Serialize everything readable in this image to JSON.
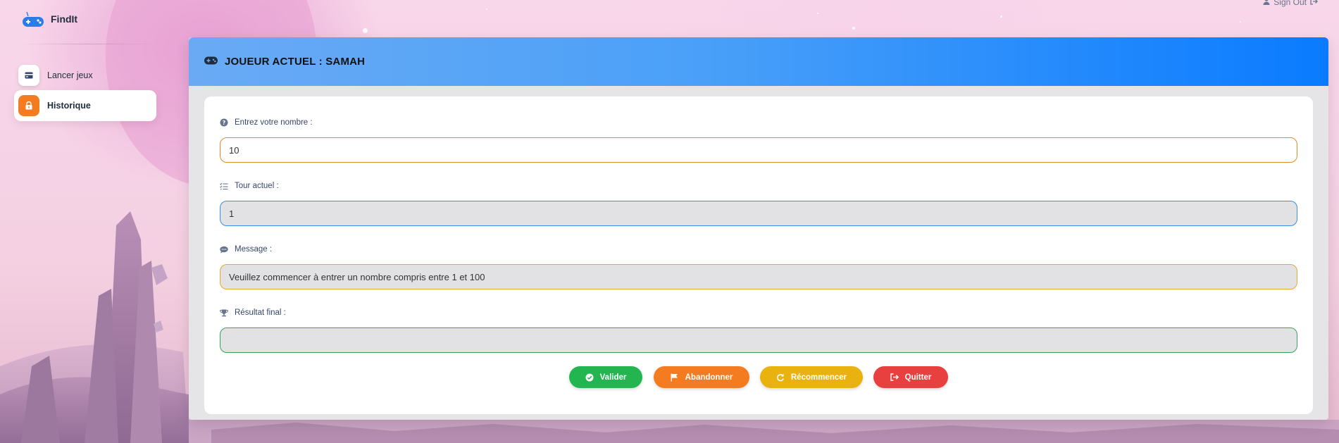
{
  "brand": {
    "name": "FindIt",
    "logo_icon": "gamepad-logo-icon"
  },
  "top_bar": {
    "signout_label": "Sign Out"
  },
  "sidebar": {
    "items": [
      {
        "label": "Lancer jeux",
        "icon": "card-icon",
        "active": false
      },
      {
        "label": "Historique",
        "icon": "lock-icon",
        "active": true
      }
    ]
  },
  "panel": {
    "title": "JOUEUR ACTUEL : SAMAH",
    "title_icon": "gamepad-icon",
    "fields": [
      {
        "label": "Entrez votre nombre :",
        "icon": "question-circle-icon",
        "value": "10",
        "border": "#e0892f"
      },
      {
        "label": "Tour actuel :",
        "icon": "list-check-icon",
        "value": "1",
        "border": "#3b8ee4"
      },
      {
        "label": "Message :",
        "icon": "comment-icon",
        "value": "Veuillez commencer à entrer un nombre compris entre 1 et 100",
        "border": "#e6a930"
      },
      {
        "label": "Résultat final :",
        "icon": "trophy-icon",
        "value": "",
        "border": "#3aa35a"
      }
    ],
    "buttons": [
      {
        "label": "Valider",
        "icon": "check-circle-icon",
        "color": "#22b550"
      },
      {
        "label": "Abandonner",
        "icon": "flag-icon",
        "color": "#f47b20"
      },
      {
        "label": "Récommencer",
        "icon": "redo-icon",
        "color": "#eab20f"
      },
      {
        "label": "Quitter",
        "icon": "sign-out-icon",
        "color": "#e8403f"
      }
    ]
  }
}
